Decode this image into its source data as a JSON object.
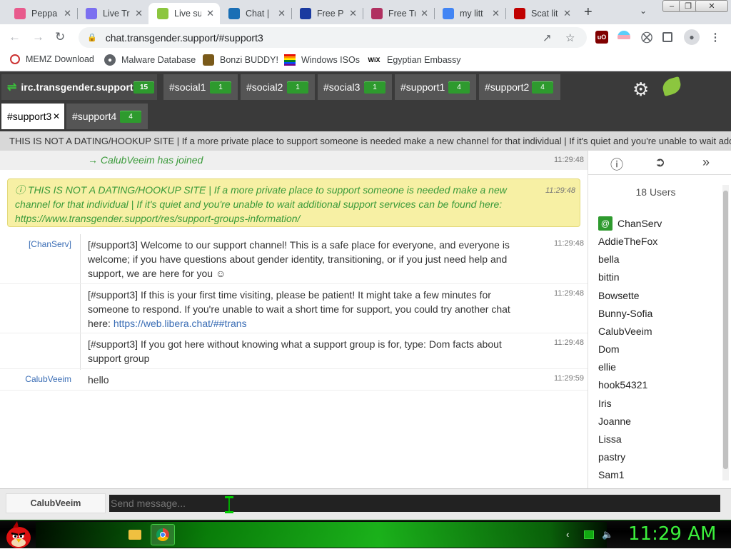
{
  "browser": {
    "tabs": [
      {
        "label": "Peppa",
        "icon": "peppa-icon",
        "color": "#e85a8c"
      },
      {
        "label": "Live Tr",
        "icon": "live-icon",
        "color": "#7b6ff0"
      },
      {
        "label": "Live su",
        "icon": "leaf-icon",
        "color": "#8cc63f",
        "active": true
      },
      {
        "label": "Chat | ",
        "icon": "chat-icon",
        "color": "#1a6fb5"
      },
      {
        "label": "Free P",
        "icon": "x-icon",
        "color": "#1a3aa0"
      },
      {
        "label": "Free Tr",
        "icon": "trans-icon",
        "color": "#b03060"
      },
      {
        "label": "my litt",
        "icon": "google-icon",
        "color": "#4285f4"
      },
      {
        "label": "Scat lit",
        "icon": "scat-icon",
        "color": "#c00000"
      }
    ],
    "new_tab": "+",
    "url": "chat.transgender.support/#support3",
    "bookmarks": [
      {
        "label": "MEMZ Download",
        "icon": "memz-icon"
      },
      {
        "label": "Malware Database",
        "icon": "globe-icon"
      },
      {
        "label": "Bonzi BUDDY!",
        "icon": "bonzi-icon"
      },
      {
        "label": "Windows ISOs",
        "icon": "windows-icon"
      },
      {
        "label": "Egyptian Embassy",
        "icon": "wix-icon",
        "icon_text": "WiX"
      }
    ]
  },
  "kiwi": {
    "network": {
      "label": "irc.transgender.support",
      "count": "15"
    },
    "channels": [
      {
        "label": "#social1",
        "count": "1"
      },
      {
        "label": "#social2",
        "count": "1"
      },
      {
        "label": "#social3",
        "count": "1"
      },
      {
        "label": "#support1",
        "count": "4"
      },
      {
        "label": "#support2",
        "count": "4"
      },
      {
        "label": "#support3",
        "close": "✕",
        "active": true
      },
      {
        "label": "#support4",
        "count": "4"
      }
    ],
    "topic": "THIS IS NOT A DATING/HOOKUP SITE | If a more private place to support someone is needed make a new channel for that individual | If it's quiet and you're unable to wait additional support services can be found here: https://www.transgender.support/res/support-groups-information/",
    "join": {
      "text": "→ CalubVeeim has joined",
      "time": "11:29:48"
    },
    "notice": {
      "text": "ⓘ THIS IS NOT A DATING/HOOKUP SITE | If a more private place to support someone is needed make a new channel for that individual | If it's quiet and you're unable to wait additional support services can be found here: https://www.transgender.support/res/support-groups-information/",
      "time": "11:29:48"
    },
    "messages": [
      {
        "nick": "[ChanServ]",
        "text": "[#support3] Welcome to our support channel! This is a safe place for everyone, and everyone is welcome; if you have questions about gender identity, transitioning, or if you just need help and support, we are here for you ☺",
        "time": "11:29:48"
      },
      {
        "nick": "",
        "text": "[#support3] If this is your first time visiting, please be patient! It might take a few minutes for someone to respond. If you're unable to wait a short time for support, you could try another chat here: ",
        "link": "https://web.libera.chat/##trans",
        "time": "11:29:48"
      },
      {
        "nick": "",
        "text": "[#support3] If you got here without knowing what a support group is for, type: Dom facts about support group",
        "time": "11:29:48"
      },
      {
        "nick": "CalubVeeim",
        "text": "hello",
        "time": "11:29:59"
      }
    ],
    "sidebar": {
      "user_count": "18 Users",
      "op_badge": "@",
      "users": [
        "ChanServ",
        "AddieTheFox",
        "bella",
        "bittin",
        "Bowsette",
        "Bunny-Sofia",
        "CalubVeeim",
        "Dom",
        "ellie",
        "hook54321",
        "Iris",
        "Joanne",
        "Lissa",
        "pastry",
        "Sam1"
      ]
    },
    "input": {
      "nick": "CalubVeeim",
      "placeholder": "Send message..."
    }
  },
  "taskbar": {
    "clock": "11:29 AM"
  }
}
